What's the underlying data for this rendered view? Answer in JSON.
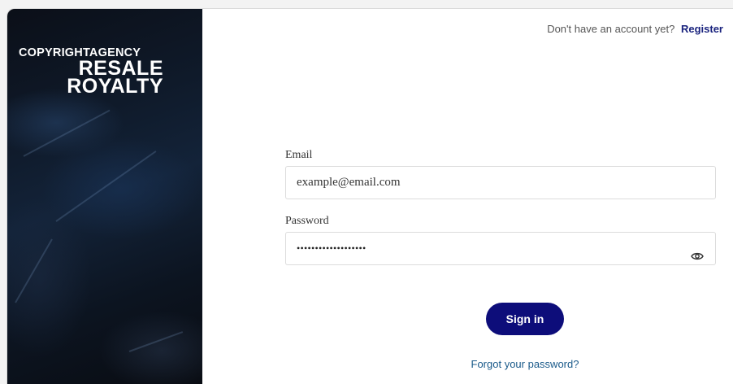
{
  "brand": {
    "top": "COPYRIGHTAGENCY",
    "line1": "RESALE",
    "line2": "ROYALTY"
  },
  "header": {
    "prompt": "Don't have an account yet?",
    "register_label": "Register"
  },
  "form": {
    "email_label": "Email",
    "email_value": "example@email.com",
    "password_label": "Password",
    "password_mask": "•••••••••••••••••••",
    "signin_label": "Sign in",
    "forgot_label": "Forgot your password?"
  },
  "colors": {
    "primary": "#0d0d7a",
    "link": "#1a237e",
    "forgot_link": "#1a5a8a"
  },
  "icons": {
    "password_toggle": "eye-icon"
  }
}
